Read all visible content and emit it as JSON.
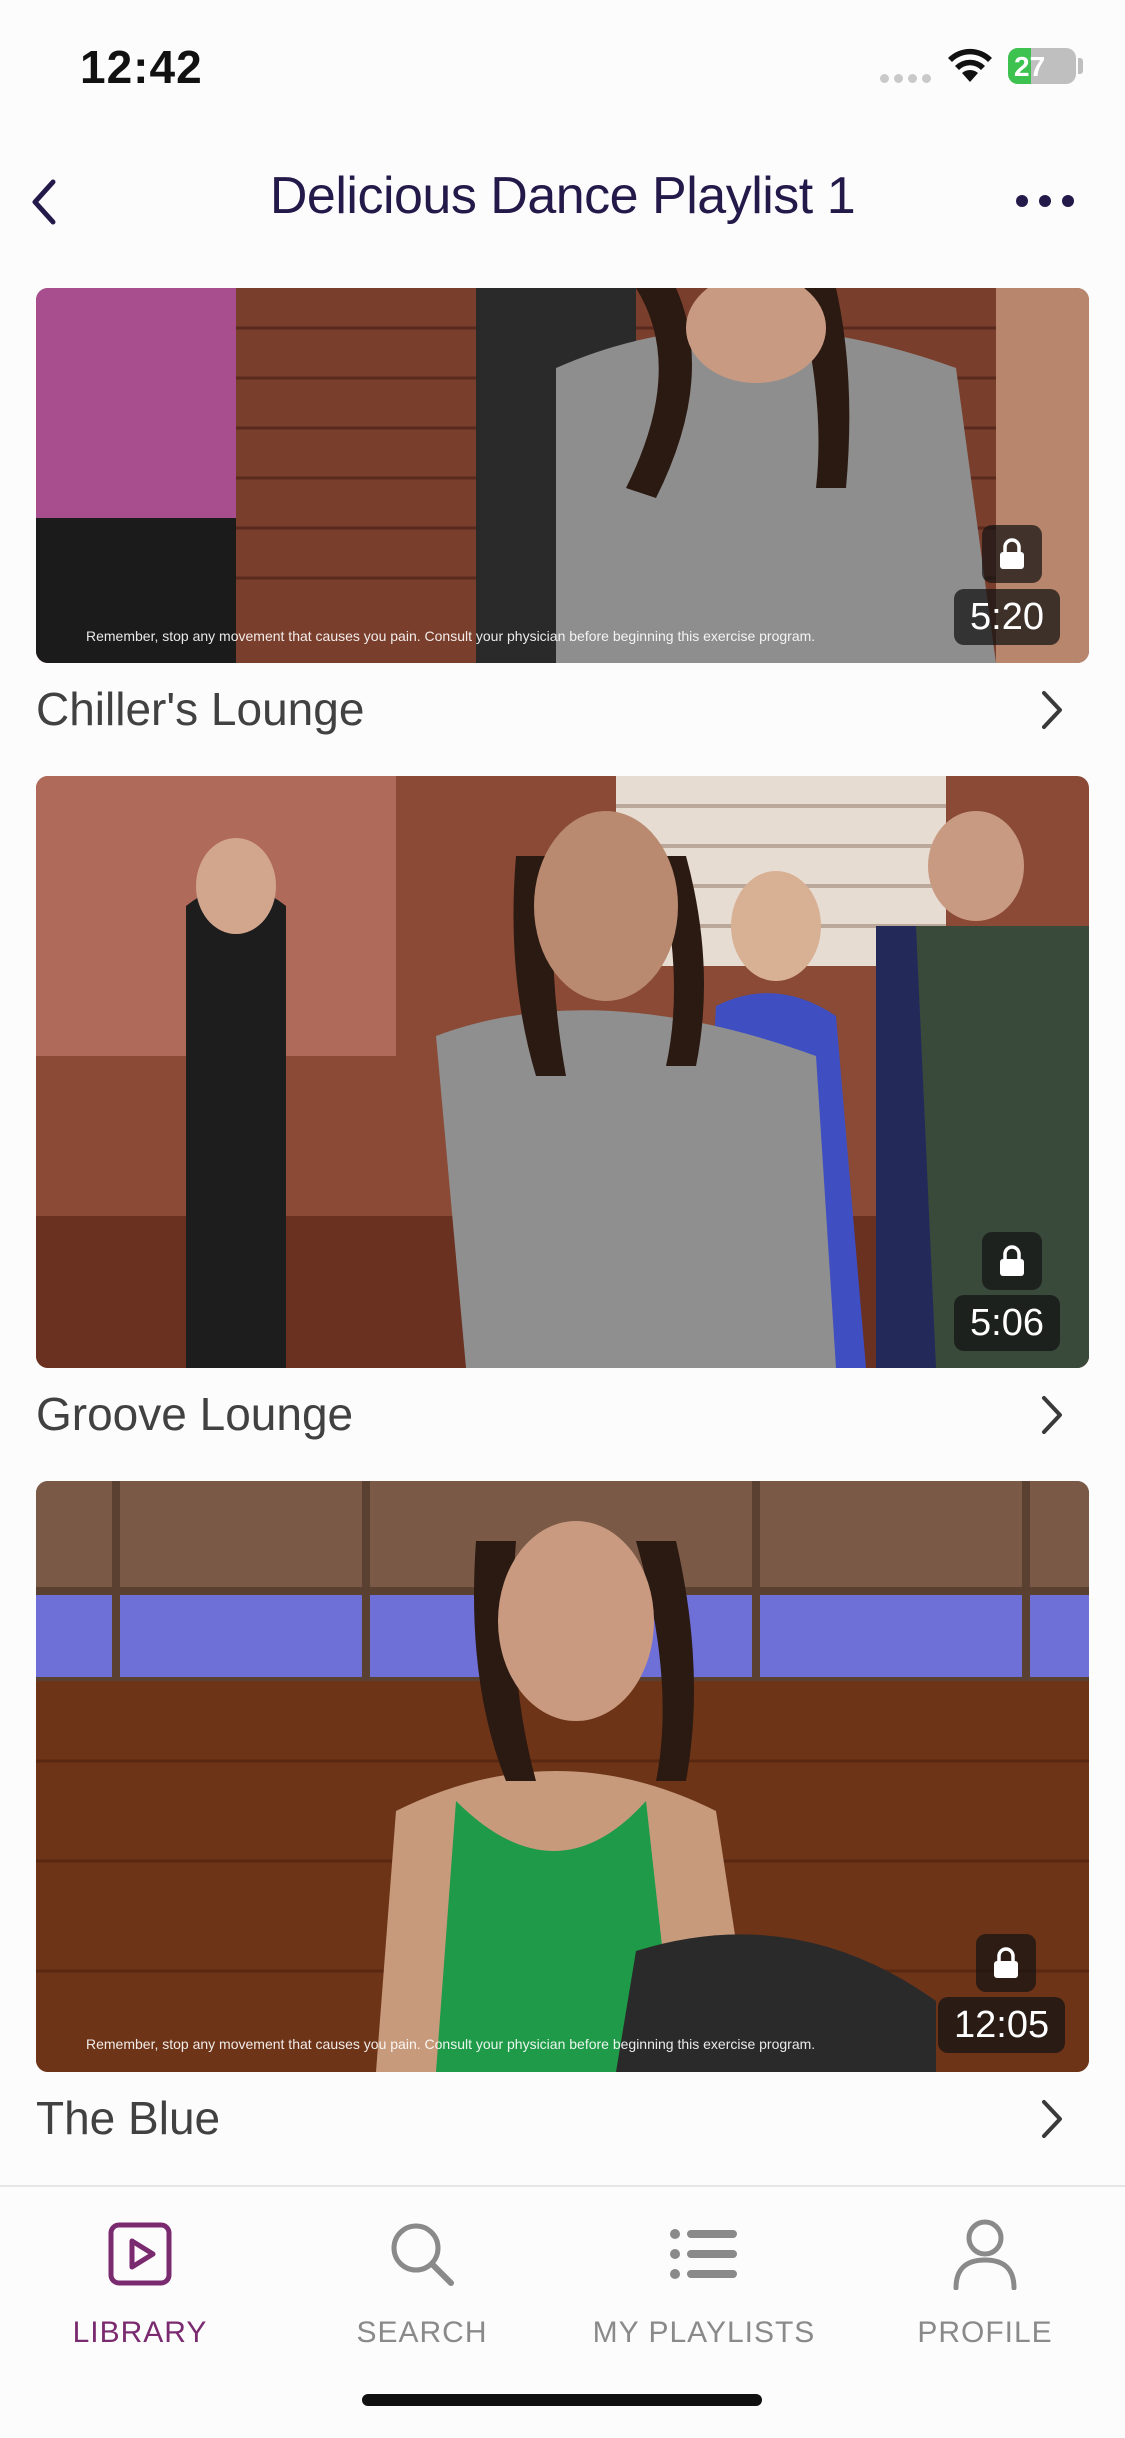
{
  "status_bar": {
    "time": "12:42",
    "battery": "27",
    "icons": [
      "cellular-signal-icon",
      "wifi-icon",
      "battery-charging-icon"
    ]
  },
  "nav": {
    "title": "Delicious Dance Playlist 1",
    "back_icon": "chevron-left-icon",
    "more_icon": "ellipsis-icon"
  },
  "videos": [
    {
      "title": "Chiller's Lounge",
      "duration": "5:20",
      "locked": true,
      "disclaimer": "Remember, stop any movement that causes you pain. Consult your physician before beginning this exercise program."
    },
    {
      "title": "Groove Lounge",
      "duration": "5:06",
      "locked": true,
      "disclaimer": ""
    },
    {
      "title": "The Blue",
      "duration": "12:05",
      "locked": true,
      "disclaimer": "Remember, stop any movement that causes you pain. Consult your physician before beginning this exercise program."
    }
  ],
  "tabs": [
    {
      "label": "LIBRARY",
      "icon": "play-square-icon",
      "active": true
    },
    {
      "label": "SEARCH",
      "icon": "search-icon",
      "active": false
    },
    {
      "label": "MY PLAYLISTS",
      "icon": "list-icon",
      "active": false
    },
    {
      "label": "PROFILE",
      "icon": "person-icon",
      "active": false
    }
  ],
  "colors": {
    "accent": "#7a2a6f",
    "title": "#241a4a",
    "inactive": "#8a8a8a"
  }
}
